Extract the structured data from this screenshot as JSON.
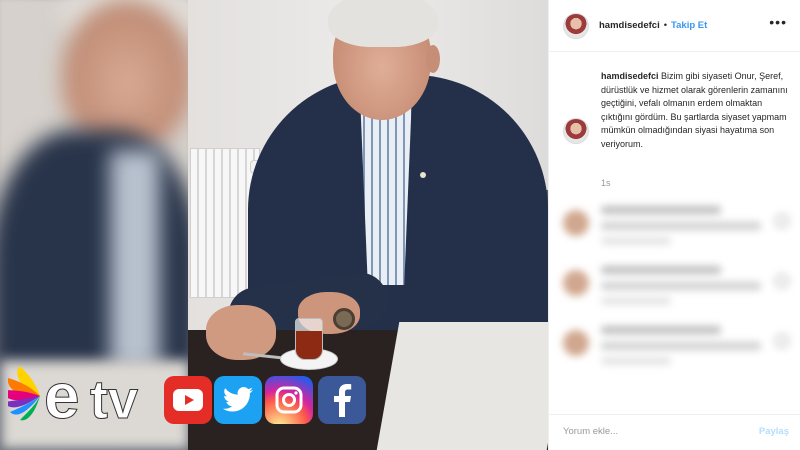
{
  "header": {
    "username": "hamdisedefci",
    "separator": "•",
    "follow_label": "Takip Et",
    "more_icon": "more-horizontal-icon",
    "more_glyph": "•••"
  },
  "caption": {
    "username": "hamdisedefci",
    "text": "Bizim gibi siyaseti Onur, Şeref, dürüstlük ve hizmet olarak görenlerin zamanını geçtiğini, vefalı olmanın erdem olmaktan çıktığını gördüm. Bu şartlarda siyaset yapmam mümkün olmadığından siyasi hayatıma son veriyorum.",
    "time": "1s"
  },
  "footer": {
    "comment_placeholder": "Yorum ekle...",
    "share_label": "Paylaş"
  },
  "logos": {
    "brand": "etv",
    "social_icons": [
      "youtube-icon",
      "twitter-icon",
      "instagram-icon",
      "facebook-icon"
    ]
  },
  "colors": {
    "link_blue": "#3897f0",
    "share_disabled": "#b2dffc",
    "youtube": "#e52d27",
    "twitter": "#1da1f2",
    "facebook": "#3b5998"
  }
}
